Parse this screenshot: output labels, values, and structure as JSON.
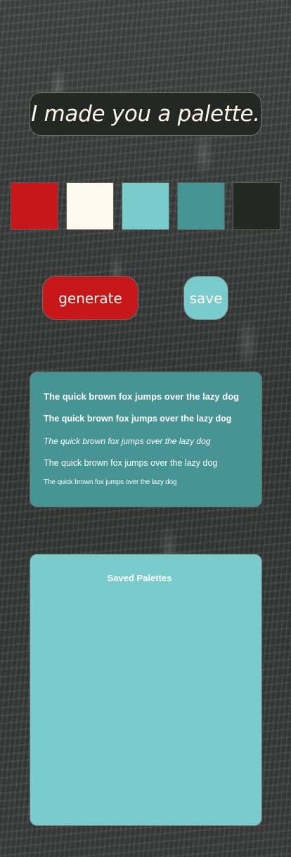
{
  "header": {
    "title": "I made you a palette."
  },
  "palette": {
    "swatches": [
      {
        "name": "swatch-red",
        "color": "#c8171a"
      },
      {
        "name": "swatch-cream",
        "color": "#fff8ec"
      },
      {
        "name": "swatch-light-teal",
        "color": "#7acbcb"
      },
      {
        "name": "swatch-teal",
        "color": "#479494"
      },
      {
        "name": "swatch-dark",
        "color": "#232825"
      }
    ]
  },
  "controls": {
    "generate_label": "generate",
    "save_label": "save"
  },
  "samples": {
    "lines": [
      "The quick brown fox jumps over the lazy dog",
      "The quick brown fox jumps over the lazy dog",
      "The quick brown fox jumps over the lazy dog",
      "The quick brown fox jumps over the lazy dog",
      "The quick brown fox jumps over the lazy dog"
    ]
  },
  "saved": {
    "title": "Saved Palettes"
  },
  "colors": {
    "title_bg": "#232825",
    "title_text": "#fff7ea",
    "generate_bg": "#c8171a",
    "save_bg": "#7acbcb",
    "sample_bg": "#479494",
    "saved_bg": "#7acbcb"
  }
}
